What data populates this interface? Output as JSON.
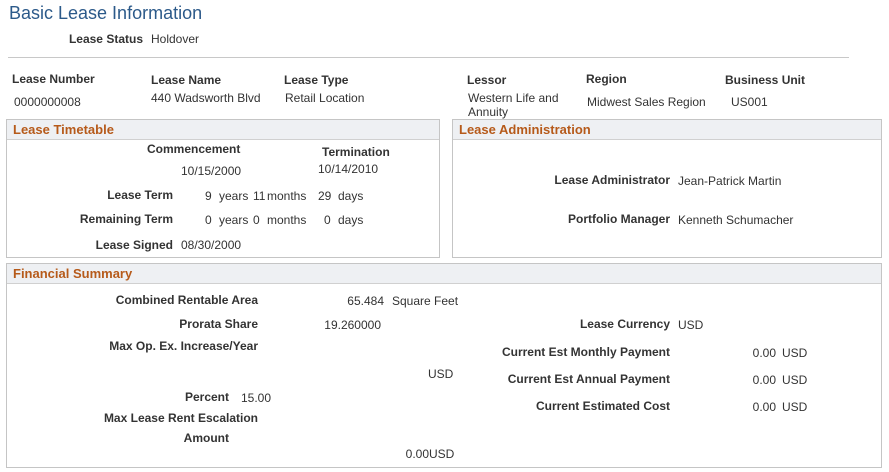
{
  "page": {
    "title": "Basic Lease Information"
  },
  "lease_status": {
    "label": "Lease Status",
    "value": "Holdover"
  },
  "header_fields": [
    {
      "label": "Lease Number",
      "value": "0000000008"
    },
    {
      "label": "Lease Name",
      "value": "440 Wadsworth Blvd"
    },
    {
      "label": "Lease Type",
      "value": "Retail Location"
    },
    {
      "label": "Lessor",
      "value_line1": "Western Life and",
      "value_line2": "Annuity"
    },
    {
      "label": "Region",
      "value": "Midwest Sales Region"
    },
    {
      "label": "Business Unit",
      "value": "US001"
    }
  ],
  "timetable": {
    "title": "Lease Timetable",
    "commencement_label": "Commencement",
    "commencement_value": "10/15/2000",
    "termination_label": "Termination",
    "termination_value": "10/14/2010",
    "lease_term": {
      "label": "Lease Term",
      "years": "9",
      "years_unit": "years",
      "months": "11",
      "months_unit": "months",
      "days": "29",
      "days_unit": "days"
    },
    "remaining_term": {
      "label": "Remaining Term",
      "years": "0",
      "years_unit": "years",
      "months": "0",
      "months_unit": "months",
      "days": "0",
      "days_unit": "days"
    },
    "lease_signed": {
      "label": "Lease Signed",
      "value": "08/30/2000"
    }
  },
  "administration": {
    "title": "Lease Administration",
    "administrator": {
      "label": "Lease Administrator",
      "value": "Jean-Patrick Martin"
    },
    "portfolio_manager": {
      "label": "Portfolio Manager",
      "value": "Kenneth Schumacher"
    }
  },
  "financial": {
    "title": "Financial Summary",
    "combined_area": {
      "label": "Combined Rentable Area",
      "value": "65.484",
      "unit": "Square Feet"
    },
    "prorata_share": {
      "label": "Prorata Share",
      "value": "19.260000"
    },
    "max_opex": {
      "label": "Max Op. Ex. Increase/Year",
      "currency": "USD"
    },
    "percent": {
      "label": "Percent",
      "value": "15.00"
    },
    "max_rent_escalation": {
      "label": "Max Lease Rent Escalation"
    },
    "amount": {
      "label": "Amount",
      "value": "0.00",
      "currency": "USD"
    },
    "lease_currency": {
      "label": "Lease Currency",
      "value": "USD"
    },
    "monthly_payment": {
      "label": "Current Est Monthly Payment",
      "value": "0.00",
      "currency": "USD"
    },
    "annual_payment": {
      "label": "Current Est Annual Payment",
      "value": "0.00",
      "currency": "USD"
    },
    "estimated_cost": {
      "label": "Current Estimated Cost",
      "value": "0.00",
      "currency": "USD"
    }
  }
}
